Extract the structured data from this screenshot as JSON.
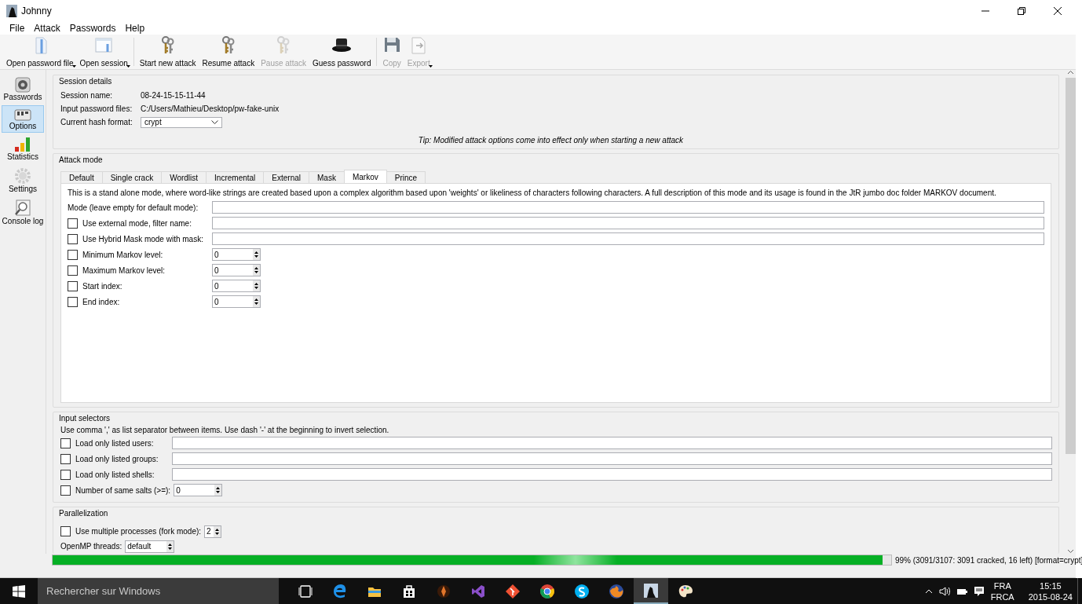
{
  "window": {
    "title": "Johnny"
  },
  "menu": [
    {
      "label": "File"
    },
    {
      "label": "Attack"
    },
    {
      "label": "Passwords"
    },
    {
      "label": "Help"
    }
  ],
  "toolbar": [
    {
      "label": "Open password file",
      "disabled": false,
      "dropdown": true
    },
    {
      "label": "Open session",
      "disabled": false,
      "dropdown": true
    },
    {
      "label": "Start new attack",
      "disabled": false,
      "dropdown": false
    },
    {
      "label": "Resume attack",
      "disabled": false,
      "dropdown": false
    },
    {
      "label": "Pause attack",
      "disabled": true,
      "dropdown": false
    },
    {
      "label": "Guess password",
      "disabled": false,
      "dropdown": false
    },
    {
      "label": "Copy",
      "disabled": true,
      "dropdown": false
    },
    {
      "label": "Export",
      "disabled": true,
      "dropdown": true
    }
  ],
  "sidebar": {
    "items": [
      {
        "label": "Passwords",
        "selected": false
      },
      {
        "label": "Options",
        "selected": true
      },
      {
        "label": "Statistics",
        "selected": false
      },
      {
        "label": "Settings",
        "selected": false
      },
      {
        "label": "Console log",
        "selected": false
      }
    ]
  },
  "session_details": {
    "title": "Session details",
    "fields": [
      {
        "label": "Session name:",
        "value": "08-24-15-15-11-44",
        "kind": "text"
      },
      {
        "label": "Input password files:",
        "value": "C:/Users/Mathieu/Desktop/pw-fake-unix",
        "kind": "text"
      },
      {
        "label": "Current hash format:",
        "value": "crypt",
        "kind": "dropdown"
      }
    ],
    "tip": "Tip: Modified attack options come into effect only when starting a new attack"
  },
  "attack_mode": {
    "title": "Attack mode",
    "tabs": [
      {
        "label": "Default",
        "selected": false
      },
      {
        "label": "Single crack",
        "selected": false
      },
      {
        "label": "Wordlist",
        "selected": false
      },
      {
        "label": "Incremental",
        "selected": false
      },
      {
        "label": "External",
        "selected": false
      },
      {
        "label": "Mask",
        "selected": false
      },
      {
        "label": "Markov",
        "selected": true
      },
      {
        "label": "Prince",
        "selected": false
      }
    ],
    "description": "This is a stand alone mode, where word-like strings are created based upon a complex algorithm based upon 'weights' or likeliness of characters following characters. A full description of this mode and its usage is found in the JtR jumbo doc folder MARKOV document.",
    "options": [
      {
        "kind": "text",
        "label": "Mode (leave empty for default mode):"
      },
      {
        "kind": "text",
        "label": "Use external mode, filter name:",
        "checked": false
      },
      {
        "kind": "text",
        "label": "Use Hybrid Mask mode with mask:",
        "checked": false
      },
      {
        "kind": "spin",
        "label": "Minimum Markov level:",
        "checked": false,
        "value": "0"
      },
      {
        "kind": "spin",
        "label": "Maximum Markov level:",
        "checked": false,
        "value": "0"
      },
      {
        "kind": "spin",
        "label": "Start index:",
        "checked": false,
        "value": "0"
      },
      {
        "kind": "spin",
        "label": "End index:",
        "checked": false,
        "value": "0"
      }
    ]
  },
  "input_selectors": {
    "title": "Input selectors",
    "hint": "Use comma ',' as list separator between items. Use dash '-' at the beginning to invert selection.",
    "options": [
      {
        "kind": "text",
        "label": "Load only listed users:",
        "checked": false
      },
      {
        "kind": "text",
        "label": "Load only listed groups:",
        "checked": false
      },
      {
        "kind": "text",
        "label": "Load only listed shells:",
        "checked": false
      },
      {
        "kind": "spin",
        "label": "Number of same salts (>=):",
        "checked": false,
        "value": "0"
      }
    ]
  },
  "parallelization": {
    "title": "Parallelization",
    "options": [
      {
        "kind": "spin",
        "label": "Use multiple processes (fork mode):",
        "checked": false,
        "value": "2"
      },
      {
        "kind": "spin",
        "label": "OpenMP threads:",
        "value": "default"
      }
    ]
  },
  "progress": {
    "level": 0.99,
    "text": "99% (3091/3107: 3091 cracked, 16 left) [format=crypt]"
  },
  "taskbar": {
    "search_placeholder": "Rechercher sur Windows",
    "apps": [
      {
        "selected": false
      },
      {
        "selected": false
      },
      {
        "selected": false
      },
      {
        "selected": false
      },
      {
        "selected": false
      },
      {
        "selected": false
      },
      {
        "selected": false
      },
      {
        "selected": false
      },
      {
        "selected": false
      },
      {
        "selected": false
      },
      {
        "selected": true
      },
      {
        "selected": false
      }
    ],
    "language": "FRA",
    "layout": "FRCA",
    "time": "15:15",
    "date": "2015-08-24"
  }
}
